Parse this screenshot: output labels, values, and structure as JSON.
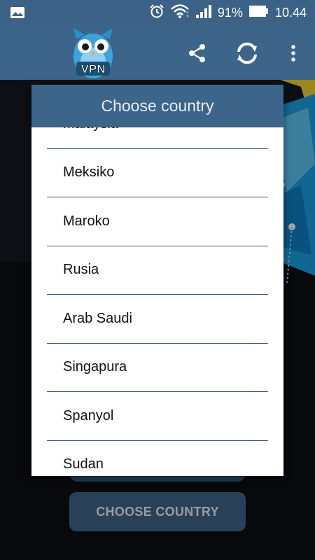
{
  "status_bar": {
    "battery_percent": "91%",
    "time": "10.44",
    "icons": [
      "image-icon",
      "alarm-icon",
      "wifi-icon",
      "signal-icon",
      "battery-icon"
    ]
  },
  "app_bar": {
    "logo_text": "VPN",
    "actions": [
      "share-icon",
      "refresh-icon",
      "more-vert-icon"
    ]
  },
  "dialog": {
    "title": "Choose country",
    "countries": [
      "Malaysia",
      "Meksiko",
      "Maroko",
      "Rusia",
      "Arab Saudi",
      "Singapura",
      "Spanyol",
      "Sudan"
    ]
  },
  "main": {
    "choose_button_label": "CHOOSE COUNTRY"
  },
  "colors": {
    "primary": "#3d6489",
    "divider": "#2c4e78",
    "background": "#0b0e14"
  }
}
